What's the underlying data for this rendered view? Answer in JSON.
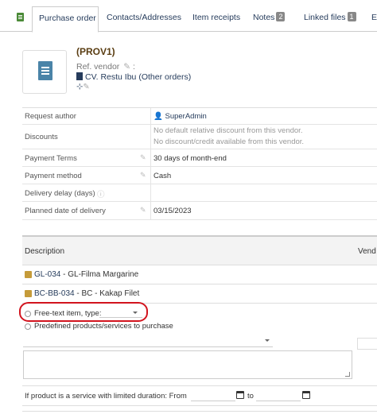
{
  "tabs": {
    "items": [
      {
        "label": "Purchase order",
        "badge": ""
      },
      {
        "label": "Contacts/Addresses",
        "badge": ""
      },
      {
        "label": "Item receipts",
        "badge": ""
      },
      {
        "label": "Notes",
        "badge": "2"
      },
      {
        "label": "Linked files",
        "badge": "1"
      },
      {
        "label": "E",
        "badge": ""
      }
    ]
  },
  "header": {
    "ref": "(PROV1)",
    "ref_vendor_label": "Ref. vendor",
    "ref_vendor_suffix": ":",
    "vendor_name": "CV. Restu Ibu",
    "vendor_other": "(Other orders)"
  },
  "info": {
    "request_author": {
      "label": "Request author",
      "value": "SuperAdmin"
    },
    "discounts": {
      "label": "Discounts",
      "line1": "No default relative discount from this vendor.",
      "line2": "No discount/credit available from this vendor."
    },
    "payment_terms": {
      "label": "Payment Terms",
      "value": "30 days of month-end"
    },
    "payment_method": {
      "label": "Payment method",
      "value": "Cash"
    },
    "delivery_delay": {
      "label": "Delivery delay (days)",
      "value": ""
    },
    "planned_date": {
      "label": "Planned date of delivery",
      "value": "03/15/2023"
    }
  },
  "lines": {
    "columns": [
      "Description",
      "Vend"
    ],
    "products": [
      {
        "code": "GL-034",
        "desc": " - GL-Filma Margarine"
      },
      {
        "code": "BC-BB-034",
        "desc": " - BC - Kakap Filet"
      }
    ]
  },
  "add_line": {
    "free_text_label": "Free-text item, type:",
    "free_text_type": "",
    "predefined_label": "Predefined products/services to purchase",
    "product_value": "",
    "description_value": "",
    "duration_label": "If product is a service with limited duration: From",
    "duration_to": "to",
    "date_from": "",
    "date_to": ""
  },
  "colors": {
    "link": "#263c5c",
    "highlight": "#d2141e",
    "ref": "#5a3d12"
  }
}
